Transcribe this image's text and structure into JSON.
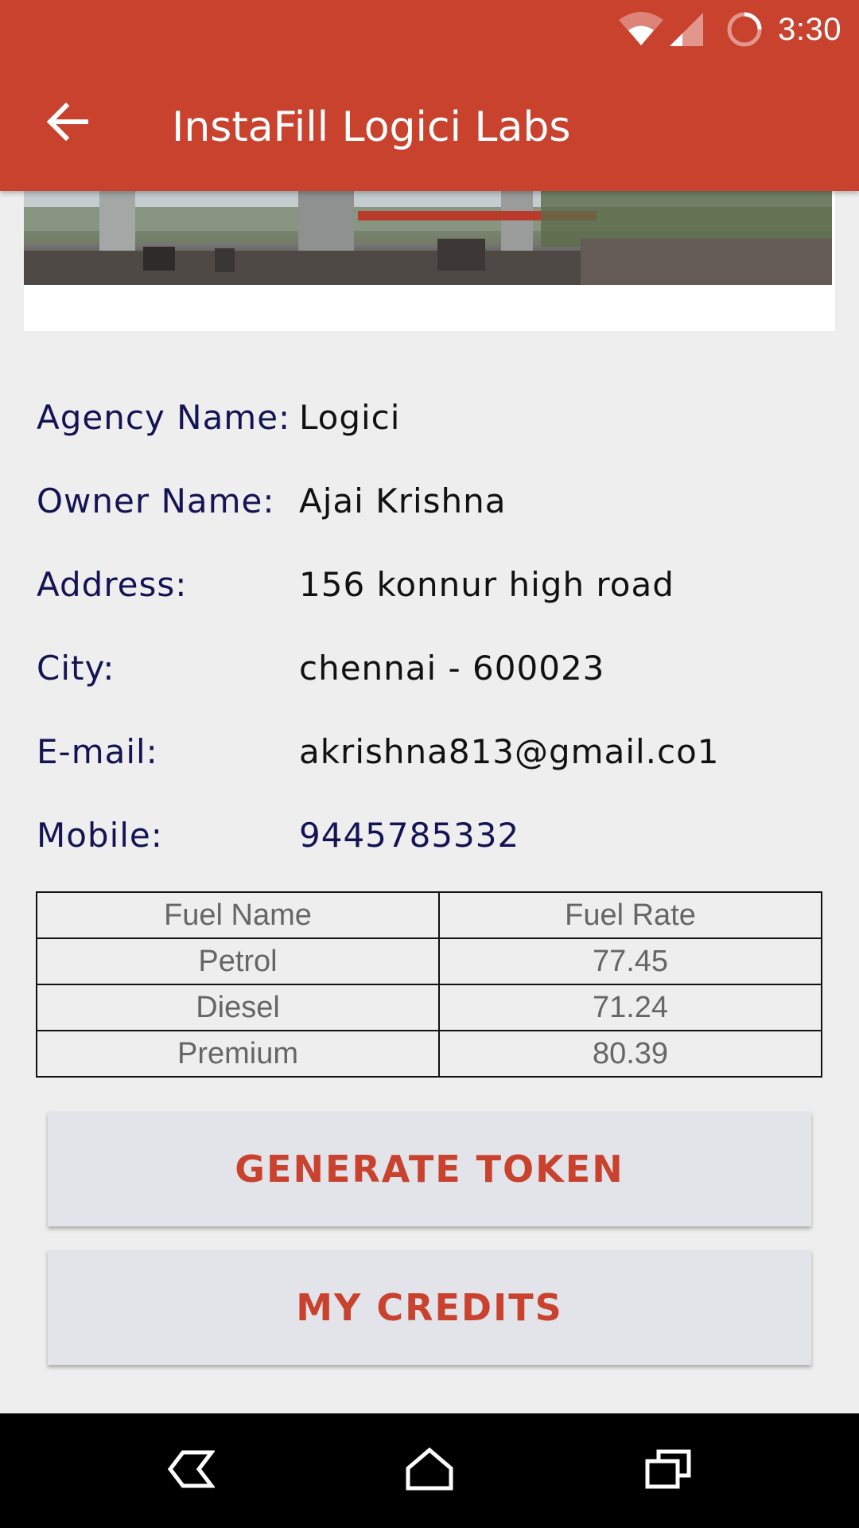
{
  "status_bar": {
    "time": "3:30",
    "icons": [
      "wifi-icon",
      "signal-icon",
      "battery-loading-icon"
    ]
  },
  "app_bar": {
    "title": "InstaFill Logici Labs",
    "back_icon": "arrow-back-icon"
  },
  "details": [
    {
      "label": "Agency Name:",
      "value": "Logici"
    },
    {
      "label": "Owner Name:",
      "value": "Ajai Krishna"
    },
    {
      "label": "Address:",
      "value": "156 konnur high road"
    },
    {
      "label": "City:",
      "value": "chennai - 600023"
    },
    {
      "label": "E-mail:",
      "value": "akrishna813@gmail.co1"
    },
    {
      "label": "Mobile:",
      "value": "9445785332"
    }
  ],
  "fuel_table": {
    "headers": [
      "Fuel Name",
      "Fuel Rate"
    ],
    "rows": [
      [
        "Petrol",
        "77.45"
      ],
      [
        "Diesel",
        "71.24"
      ],
      [
        "Premium",
        "80.39"
      ]
    ]
  },
  "buttons": {
    "generate_token": "GENERATE TOKEN",
    "my_credits": "MY CREDITS"
  },
  "nav_bar": {
    "icons": [
      "back-nav-icon",
      "home-nav-icon",
      "recents-nav-icon"
    ]
  },
  "colors": {
    "primary": "#c9422e",
    "label": "#141454",
    "button_bg": "#e3e3ea"
  }
}
